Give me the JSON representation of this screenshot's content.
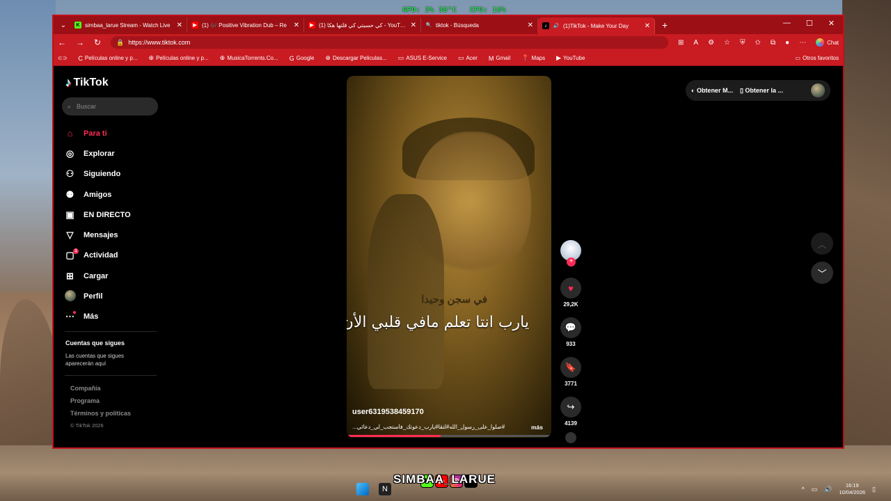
{
  "overlay": {
    "gpu": "GPU: 3% 38°C",
    "cpu": "CPU: 18%"
  },
  "browser": {
    "tabs": [
      {
        "title": "simbaa_larue Stream - Watch Live",
        "favicon": "K"
      },
      {
        "title": "(1) 🎶 Positive Vibration Dub – Re",
        "favicon": "▶"
      },
      {
        "title": "(1) كي حسيتي كي قلتها هكا - YouTube",
        "favicon": "▶"
      },
      {
        "title": "tiktok - Búsqueda",
        "favicon": "🔍"
      },
      {
        "title": "(1)TikTok - Make Your Day",
        "favicon": "♪"
      }
    ],
    "new_tab": "+",
    "url": "https://www.tiktok.com",
    "chat_label": "Chat",
    "bookmarks": [
      "Películas online y p...",
      "Películas online y p...",
      "MusicaTorrents.Co...",
      "Google",
      "Descargar Peliculas...",
      "ASUS E-Service",
      "Acer",
      "Gmail",
      "Maps",
      "YouTube"
    ],
    "other_favorites": "Otros favoritos"
  },
  "tiktok": {
    "logo": "TikTok",
    "search_placeholder": "Buscar",
    "nav": [
      {
        "label": "Para ti",
        "icon": "home-icon"
      },
      {
        "label": "Explorar",
        "icon": "compass-icon"
      },
      {
        "label": "Siguiendo",
        "icon": "following-icon"
      },
      {
        "label": "Amigos",
        "icon": "friends-icon"
      },
      {
        "label": "EN DIRECTO",
        "icon": "live-icon"
      },
      {
        "label": "Mensajes",
        "icon": "send-icon"
      },
      {
        "label": "Actividad",
        "icon": "inbox-icon",
        "badge": "1"
      },
      {
        "label": "Cargar",
        "icon": "upload-icon"
      },
      {
        "label": "Perfil",
        "icon": "profile-avatar"
      },
      {
        "label": "Más",
        "icon": "more-icon"
      }
    ],
    "following_title": "Cuentas que sigues",
    "following_desc": "Las cuentas que sigues aparecerán aquí",
    "footer": [
      "Compañía",
      "Programa",
      "Términos y políticas"
    ],
    "copyright": "© TikTok 2026",
    "get_app_1": "Obtener M...",
    "get_app_2": "Obtener la ..."
  },
  "video": {
    "caption_line1": "في سجن وحيدا",
    "caption_line2": "يارب انتا تعلم مافي قلبي الأن",
    "username": "user6319538459170",
    "description": "#صلوا_على_رسول_الله#لتقا#يارب_دعوتك_فأستجب_لي_دعائي...",
    "more": "más",
    "progress": 0.46,
    "likes": "29,2K",
    "comments": "933",
    "saves": "3771",
    "shares": "4139"
  },
  "desktop": {
    "streamer_name": "SIMBAA_LARUE",
    "time": "16:19",
    "date": "10/04/2026"
  }
}
